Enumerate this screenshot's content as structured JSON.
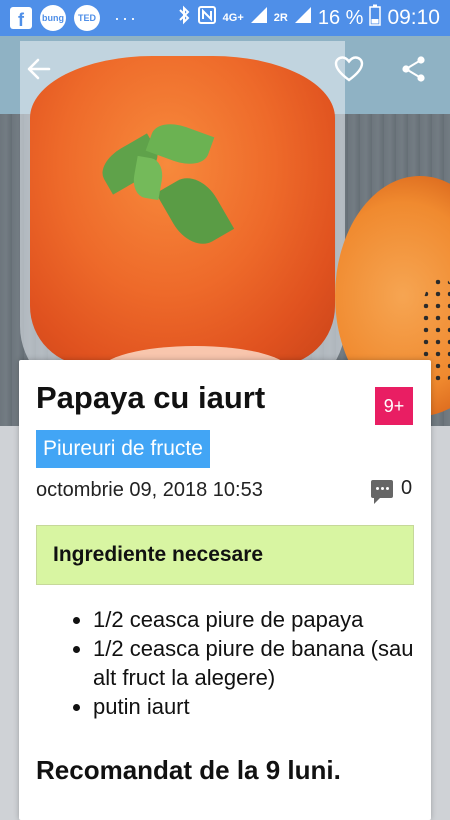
{
  "status_bar": {
    "left_icons": [
      "facebook-icon",
      "bung-icon",
      "ted-icon",
      "more-dots-icon"
    ],
    "bung": "bung",
    "ted": "TED",
    "dots": "···",
    "network": "4G+",
    "network2": "2R",
    "battery_percent": "16 %",
    "time": "09:10"
  },
  "appbar": {
    "icons": [
      "back-arrow-icon",
      "heart-icon",
      "share-icon"
    ]
  },
  "recipe": {
    "title": "Papaya cu iaurt",
    "age_badge": "9+",
    "category": "Piureuri de fructe",
    "date": "octombrie 09, 2018 10:53",
    "comment_count": "0",
    "ingredients_heading": "Ingrediente necesare",
    "ingredients": [
      "1/2 ceasca piure de papaya",
      "1/2 ceasca piure de banana (sau alt fruct la alegere)",
      "putin iaurt"
    ],
    "recommendation": "Recomandat de la 9 luni."
  },
  "colors": {
    "status_bar": "#4f8fe8",
    "age_badge": "#e91e63",
    "category_chip": "#42a5f5",
    "ingredients_box": "#d8f5a2"
  }
}
